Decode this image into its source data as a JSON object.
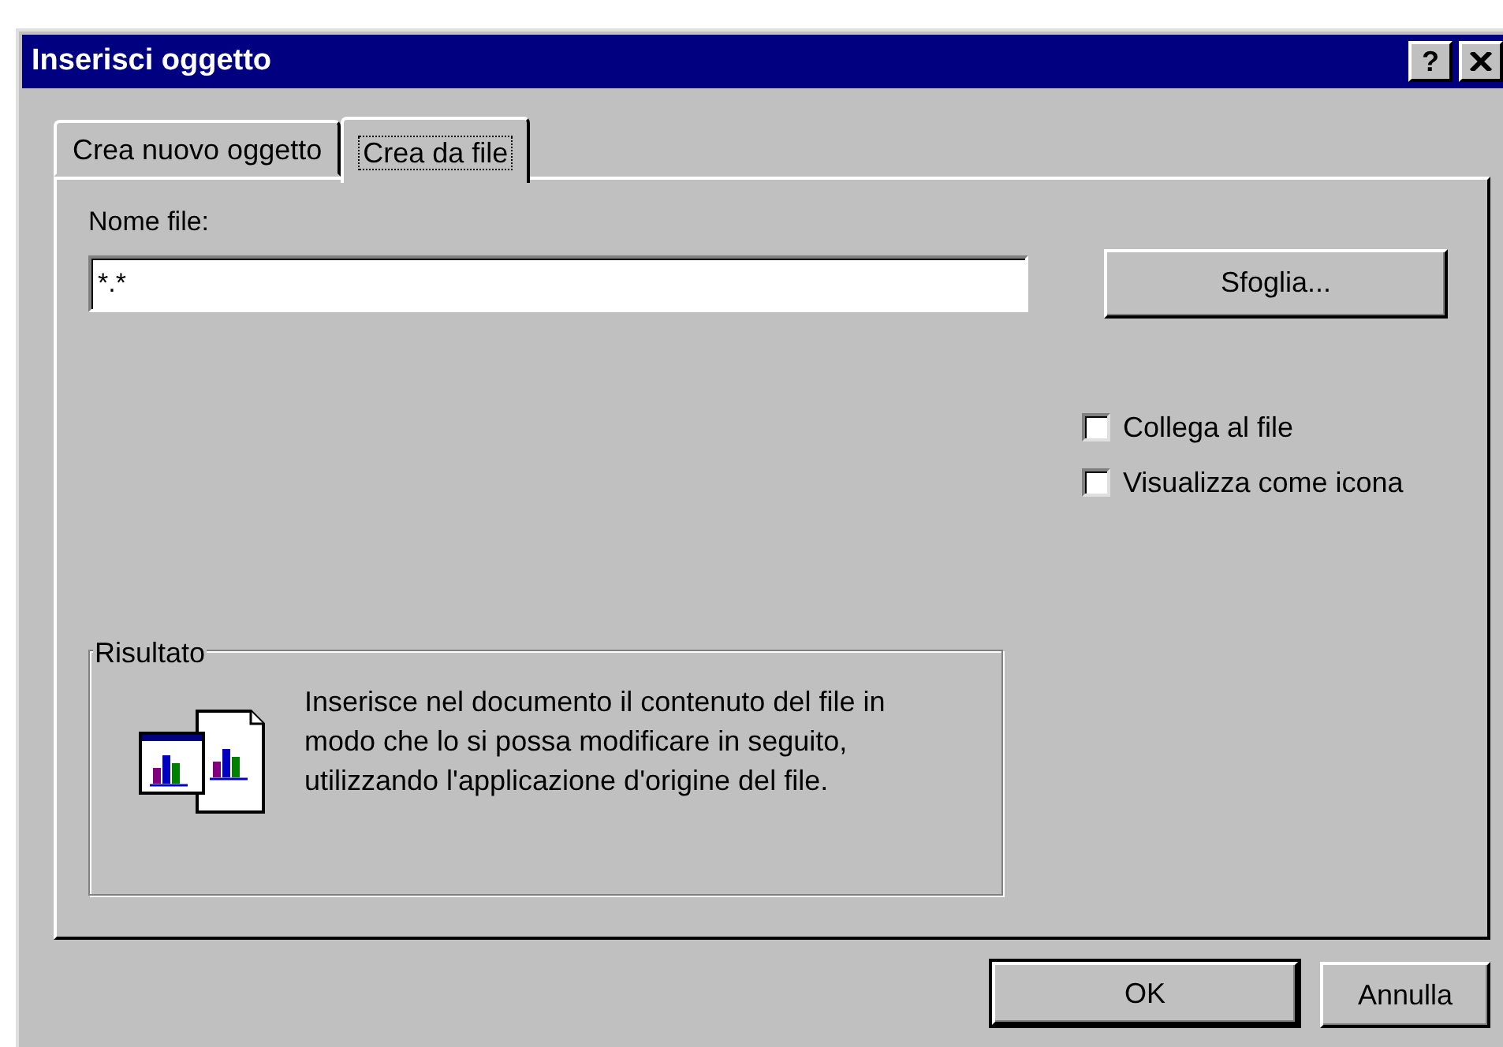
{
  "window": {
    "title": "Inserisci oggetto",
    "help_button": "?"
  },
  "tabs": [
    {
      "label": "Crea nuovo oggetto",
      "selected": false
    },
    {
      "label": "Crea da file",
      "selected": true
    }
  ],
  "file_name": {
    "label": "Nome file:",
    "value": "*.*"
  },
  "browse_button": "Sfoglia...",
  "options": [
    {
      "label": "Collega al file",
      "checked": false
    },
    {
      "label": "Visualizza come icona",
      "checked": false
    }
  ],
  "result": {
    "legend": "Risultato",
    "text": "Inserisce nel documento il contenuto del file in modo che lo si possa modificare in seguito, utilizzando l'applicazione d'origine del file."
  },
  "buttons": [
    {
      "label": "OK",
      "default": true
    },
    {
      "label": "Annulla",
      "default": false
    }
  ]
}
